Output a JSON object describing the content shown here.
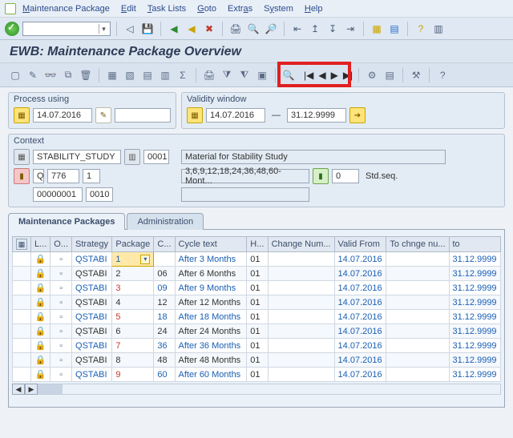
{
  "menu": {
    "items": [
      "Maintenance Package",
      "Edit",
      "Task Lists",
      "Goto",
      "Extras",
      "System",
      "Help"
    ]
  },
  "page": {
    "title": "EWB: Maintenance Package Overview"
  },
  "process": {
    "label": "Process using",
    "date": "14.07.2016"
  },
  "validity": {
    "label": "Validity window",
    "from": "14.07.2016",
    "to": "31.12.9999"
  },
  "context": {
    "label": "Context",
    "study": "STABILITY_STUDY",
    "study_no": "0001",
    "material_label": "Material for Stability Study",
    "q_code": "776",
    "q_rev": "1",
    "cycle_text": "3,6,9,12,18,24,36,48,60-Mont...",
    "seq_no": "0",
    "seq_label": "Std.seq.",
    "id1": "00000001",
    "id2": "0010"
  },
  "tabs": {
    "t1": "Maintenance Packages",
    "t2": "Administration"
  },
  "table": {
    "headers": {
      "l": "L...",
      "o": "O...",
      "strategy": "Strategy",
      "package": "Package",
      "c": "C...",
      "cycle": "Cycle text",
      "h": "H...",
      "change": "Change Num...",
      "valid": "Valid From",
      "tochg": "To chnge nu...",
      "to": "to"
    },
    "rows": [
      {
        "strategy": "QSTABI",
        "pkg": "1",
        "c": "",
        "cycle": "After 3 Months",
        "h": "01",
        "valid": "14.07.2016",
        "to": "31.12.9999",
        "link": true,
        "red": false,
        "sel": true
      },
      {
        "strategy": "QSTABI",
        "pkg": "2",
        "c": "06",
        "cycle": "After 6 Months",
        "h": "01",
        "valid": "14.07.2016",
        "to": "31.12.9999",
        "link": false,
        "red": false
      },
      {
        "strategy": "QSTABI",
        "pkg": "3",
        "c": "09",
        "cycle": "After 9 Months",
        "h": "01",
        "valid": "14.07.2016",
        "to": "31.12.9999",
        "link": true,
        "red": true
      },
      {
        "strategy": "QSTABI",
        "pkg": "4",
        "c": "12",
        "cycle": "After 12 Months",
        "h": "01",
        "valid": "14.07.2016",
        "to": "31.12.9999",
        "link": false,
        "red": false
      },
      {
        "strategy": "QSTABI",
        "pkg": "5",
        "c": "18",
        "cycle": "After 18 Months",
        "h": "01",
        "valid": "14.07.2016",
        "to": "31.12.9999",
        "link": true,
        "red": true
      },
      {
        "strategy": "QSTABI",
        "pkg": "6",
        "c": "24",
        "cycle": "After 24 Months",
        "h": "01",
        "valid": "14.07.2016",
        "to": "31.12.9999",
        "link": false,
        "red": false
      },
      {
        "strategy": "QSTABI",
        "pkg": "7",
        "c": "36",
        "cycle": "After 36 Months",
        "h": "01",
        "valid": "14.07.2016",
        "to": "31.12.9999",
        "link": true,
        "red": true
      },
      {
        "strategy": "QSTABI",
        "pkg": "8",
        "c": "48",
        "cycle": "After 48 Months",
        "h": "01",
        "valid": "14.07.2016",
        "to": "31.12.9999",
        "link": false,
        "red": false
      },
      {
        "strategy": "QSTABI",
        "pkg": "9",
        "c": "60",
        "cycle": "After 60 Months",
        "h": "01",
        "valid": "14.07.2016",
        "to": "31.12.9999",
        "link": true,
        "red": true
      }
    ]
  }
}
